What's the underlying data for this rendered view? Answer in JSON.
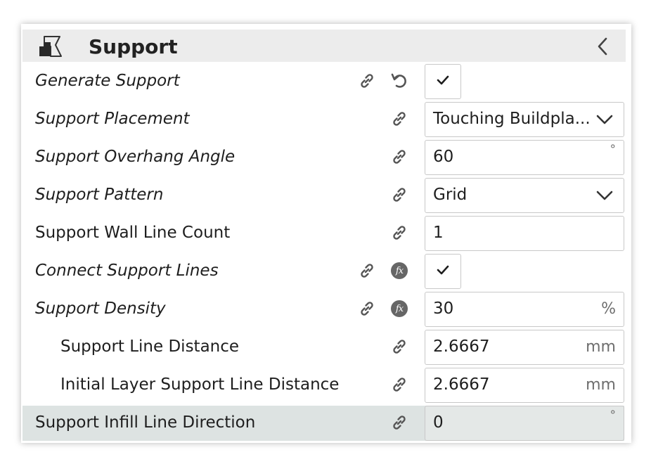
{
  "header": {
    "title": "Support",
    "icon": "support-icon",
    "collapse_icon": "chevron-left-icon"
  },
  "rows": [
    {
      "label": "Generate Support",
      "italic": true,
      "icons": [
        "link-icon",
        "reset-icon"
      ],
      "control": "checkbox",
      "checked": true
    },
    {
      "label": "Support Placement",
      "italic": true,
      "icons": [
        "link-icon"
      ],
      "control": "dropdown",
      "value": "Touching Buildpla..."
    },
    {
      "label": "Support Overhang Angle",
      "italic": true,
      "icons": [
        "link-icon"
      ],
      "control": "number",
      "value": "60",
      "unit": "°"
    },
    {
      "label": "Support Pattern",
      "italic": true,
      "icons": [
        "link-icon"
      ],
      "control": "dropdown",
      "value": "Grid"
    },
    {
      "label": "Support Wall Line Count",
      "italic": false,
      "icons": [
        "link-icon"
      ],
      "control": "number",
      "value": "1",
      "unit": ""
    },
    {
      "label": "Connect Support Lines",
      "italic": true,
      "icons": [
        "link-icon",
        "function-icon"
      ],
      "control": "checkbox",
      "checked": true
    },
    {
      "label": "Support Density",
      "italic": true,
      "icons": [
        "link-icon",
        "function-icon"
      ],
      "control": "number",
      "value": "30",
      "unit": "%"
    },
    {
      "label": "Support Line Distance",
      "italic": false,
      "indent": true,
      "icons": [
        "link-icon"
      ],
      "control": "number",
      "value": "2.6667",
      "unit": "mm"
    },
    {
      "label": "Initial Layer Support Line Distance",
      "italic": false,
      "indent": true,
      "icons": [
        "link-icon"
      ],
      "control": "number",
      "value": "2.6667",
      "unit": "mm"
    },
    {
      "label": "Support Infill Line Direction",
      "italic": false,
      "highlighted": true,
      "icons": [
        "link-icon"
      ],
      "control": "number",
      "value": "0",
      "unit": "°"
    }
  ],
  "fx_glyph": "fx",
  "colors": {
    "header_bg": "#ececec",
    "highlight_bg": "#dde3e2",
    "field_border": "#c8c8c8",
    "icon_gray": "#666666"
  }
}
